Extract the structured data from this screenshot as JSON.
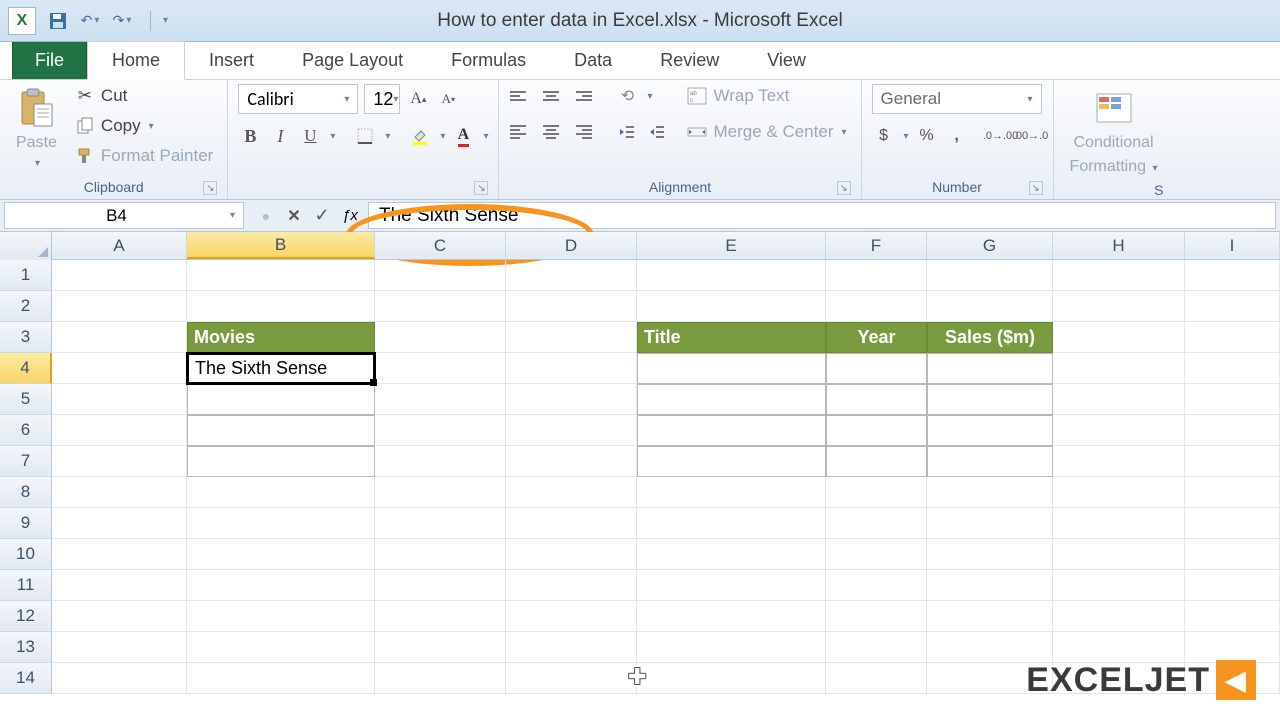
{
  "title": "How to enter data in Excel.xlsx - Microsoft Excel",
  "app_icon_letter": "X",
  "tabs": {
    "file": "File",
    "list": [
      "Home",
      "Insert",
      "Page Layout",
      "Formulas",
      "Data",
      "Review",
      "View"
    ],
    "active": 0
  },
  "ribbon": {
    "clipboard": {
      "label": "Clipboard",
      "paste": "Paste",
      "cut": "Cut",
      "copy": "Copy",
      "format_painter": "Format Painter"
    },
    "font": {
      "label": "Font",
      "name": "Calibri",
      "size": "12",
      "bold": "B",
      "italic": "I",
      "underline": "U"
    },
    "alignment": {
      "label": "Alignment",
      "wrap_text": "Wrap Text",
      "merge_center": "Merge & Center"
    },
    "number": {
      "label": "Number",
      "format": "General",
      "currency": "$",
      "percent": "%",
      "comma": ","
    },
    "styles": {
      "conditional": "Conditional",
      "formatting": "Formatting"
    }
  },
  "formula_bar": {
    "name_box": "B4",
    "formula": "The Sixth Sense"
  },
  "columns": [
    "A",
    "B",
    "C",
    "D",
    "E",
    "F",
    "G",
    "H",
    "I"
  ],
  "rows": [
    "1",
    "2",
    "3",
    "4",
    "5",
    "6",
    "7",
    "8",
    "9",
    "10",
    "11",
    "12",
    "13",
    "14"
  ],
  "selected_col": "B",
  "selected_row": "4",
  "cells": {
    "B3": "Movies",
    "B4": "The Sixth Sense",
    "E3": "Title",
    "F3": "Year",
    "G3": "Sales ($m)"
  },
  "watermark": {
    "text": "EXCELJET",
    "icon": "◀"
  }
}
